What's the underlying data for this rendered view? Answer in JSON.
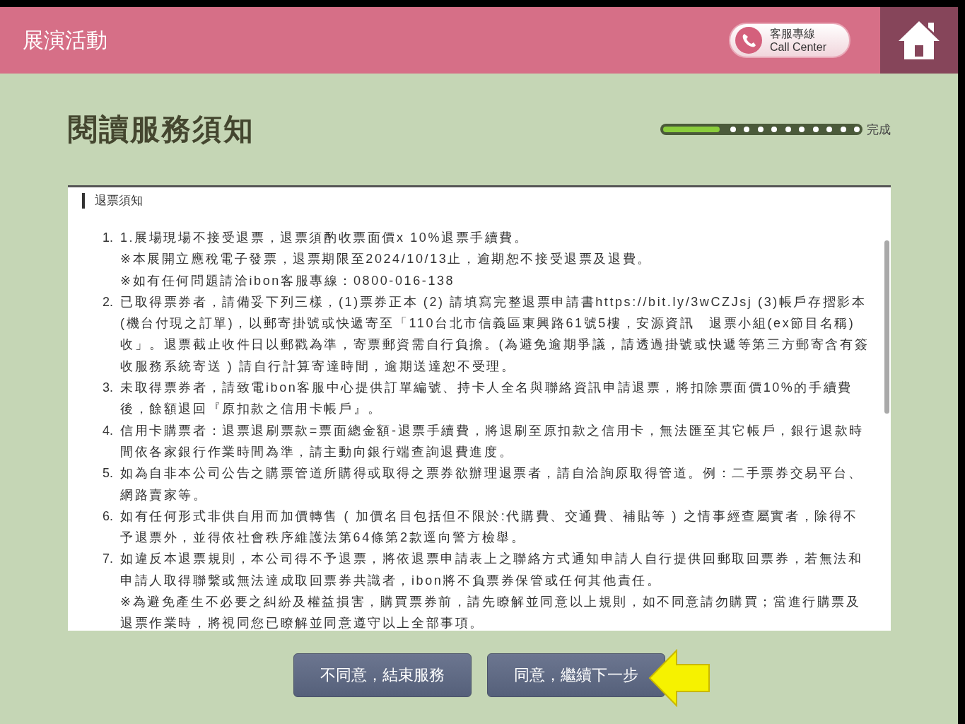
{
  "header": {
    "title": "展演活動",
    "call_center": {
      "label_zh": "客服專線",
      "label_en": "Call Center"
    }
  },
  "page_title": "閱讀服務須知",
  "progress": {
    "level": 0.28,
    "end_label": "完成"
  },
  "notice": {
    "heading": "退票須知",
    "items": [
      {
        "number": "1.",
        "paragraphs": [
          "1.展場現場不接受退票，退票須酌收票面價x 10%退票手續費。",
          "※本展開立應稅電子發票，退票期限至2024/10/13止，逾期恕不接受退票及退費。",
          "※如有任何問題請洽ibon客服專線：0800-016-138"
        ]
      },
      {
        "number": "2.",
        "paragraphs": [
          "已取得票券者，請備妥下列三樣，(1)票券正本  (2)  請填寫完整退票申請書https://bit.ly/3wCZJsj  (3)帳戶存摺影本(機台付現之訂單)，以郵寄掛號或快遞寄至「110台北市信義區東興路61號5樓，安源資訊　退票小組(ex節目名稱)收」。退票截止收件日以郵戳為準，寄票郵資需自行負擔。(為避免逾期爭議，請透過掛號或快遞等第三方郵寄含有簽收服務系統寄送 ) 請自行計算寄達時間，逾期送達恕不受理。"
        ]
      },
      {
        "number": "3.",
        "paragraphs": [
          "未取得票券者，請致電ibon客服中心提供訂單編號、持卡人全名與聯絡資訊申請退票，將扣除票面價10%的手續費後，餘額退回『原扣款之信用卡帳戶』。"
        ]
      },
      {
        "number": "4.",
        "paragraphs": [
          "信用卡購票者：退票退刷票款=票面總金額-退票手續費，將退刷至原扣款之信用卡，無法匯至其它帳戶，銀行退款時間依各家銀行作業時間為準，請主動向銀行端查詢退費進度。"
        ]
      },
      {
        "number": "5.",
        "paragraphs": [
          "如為自非本公司公告之購票管道所購得或取得之票券欲辦理退票者，請自洽詢原取得管道。例：二手票券交易平台、網路賣家等。"
        ]
      },
      {
        "number": "6.",
        "paragraphs": [
          "如有任何形式非供自用而加價轉售 ( 加價名目包括但不限於:代購費、交通費、補貼等 ) 之情事經查屬實者，除得不予退票外，並得依社會秩序維護法第64條第2款逕向警方檢舉。"
        ]
      },
      {
        "number": "7.",
        "paragraphs": [
          "如違反本退票規則，本公司得不予退票，將依退票申請表上之聯絡方式通知申請人自行提供回郵取回票券，若無法和申請人取得聯繫或無法達成取回票券共識者，ibon將不負票券保管或任何其他責任。",
          "※為避免產生不必要之糾紛及權益損害，購買票券前，請先瞭解並同意以上規則，如不同意請勿購買；當進行購票及退票作業時，將視同您已瞭解並同意遵守以上全部事項。"
        ]
      }
    ]
  },
  "buttons": [
    {
      "label": "不同意，結束服務",
      "kind": "decline"
    },
    {
      "label": "同意，繼續下一步",
      "kind": "accept"
    }
  ]
}
